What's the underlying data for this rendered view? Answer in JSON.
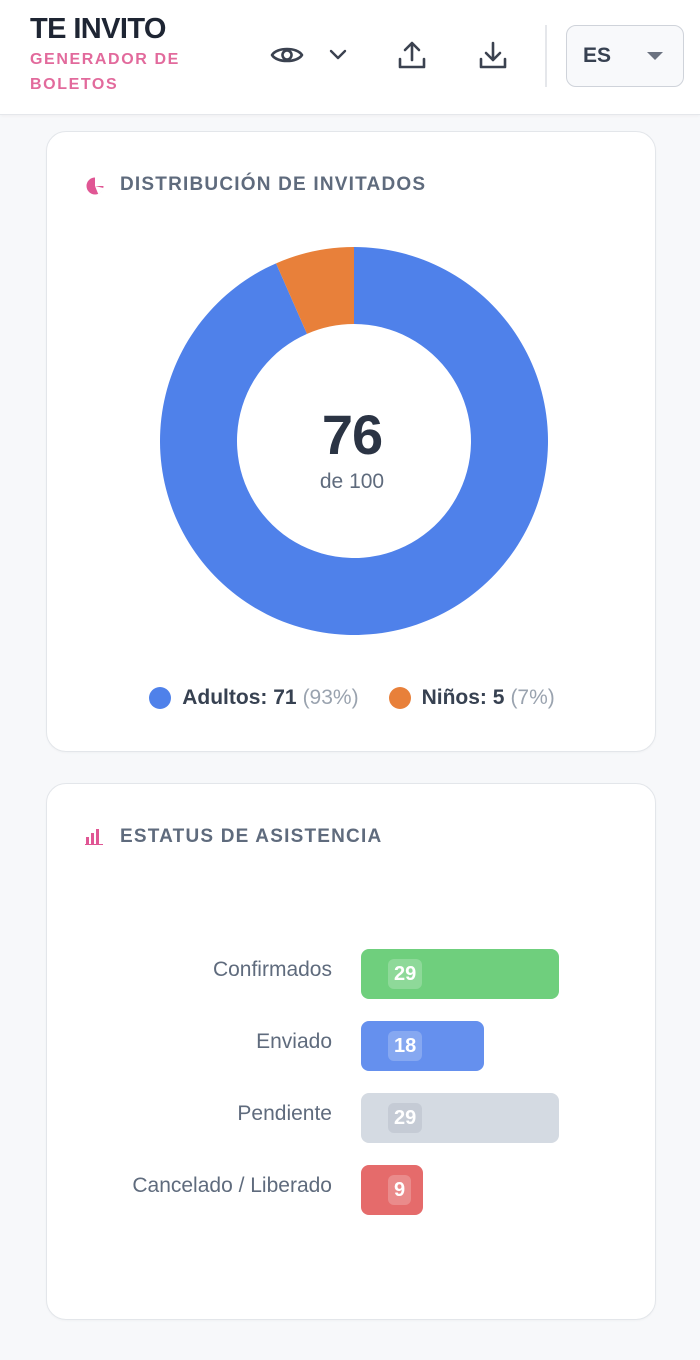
{
  "header": {
    "title": "TE INVITO",
    "subtitle": "GENERADOR DE BOLETOS",
    "icons": [
      "eye-icon",
      "chevron-down-icon",
      "upload-icon",
      "download-icon"
    ],
    "language": "ES"
  },
  "distribution": {
    "title": "DISTRIBUCIÓN DE INVITADOS",
    "icon": "pie-chart-icon",
    "total": "76",
    "of_label": "de 100",
    "legend": [
      {
        "label": "Adultos: 71",
        "pct": "(93%)",
        "color": "#4f81ea"
      },
      {
        "label": "Niños: 5",
        "pct": "(7%)",
        "color": "#e8803a"
      }
    ]
  },
  "status": {
    "title": "ESTATUS DE ASISTENCIA",
    "icon": "bar-chart-icon",
    "items": [
      {
        "label": "Confirmados",
        "value": "29",
        "color": "#6fcf7d"
      },
      {
        "label": "Enviado",
        "value": "18",
        "color": "#6590ee"
      },
      {
        "label": "Pendiente",
        "value": "29",
        "color": "#d4dae2"
      },
      {
        "label": "Cancelado / Liberado",
        "value": "9",
        "color": "#e56b6b"
      }
    ]
  },
  "chart_data": [
    {
      "type": "pie",
      "title": "DISTRIBUCIÓN DE INVITADOS",
      "categories": [
        "Adultos",
        "Niños"
      ],
      "values": [
        71,
        5
      ],
      "colors": [
        "#4f81ea",
        "#e8803a"
      ],
      "center_value": 76,
      "center_of": 100,
      "legend": "bottom"
    },
    {
      "type": "bar",
      "orientation": "horizontal",
      "title": "ESTATUS DE ASISTENCIA",
      "categories": [
        "Confirmados",
        "Enviado",
        "Pendiente",
        "Cancelado / Liberado"
      ],
      "values": [
        29,
        18,
        29,
        9
      ],
      "colors": [
        "#6fcf7d",
        "#6590ee",
        "#d4dae2",
        "#e56b6b"
      ],
      "xlim": [
        0,
        29
      ]
    }
  ]
}
